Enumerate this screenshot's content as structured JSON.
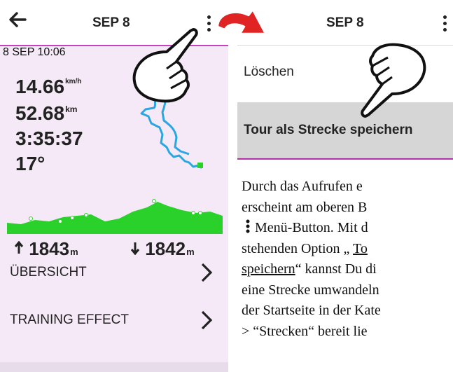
{
  "left_screen": {
    "back_icon": "arrow-left-icon",
    "title": "SEP 8",
    "menu_icon": "kebab-menu-icon",
    "timestamp": "8 SEP 10:06",
    "stats": [
      {
        "value": "14.66",
        "unit": "km/h"
      },
      {
        "value": "52.68",
        "unit": "km"
      },
      {
        "value": "3:35:37",
        "unit": ""
      },
      {
        "value": "17°",
        "unit": ""
      }
    ],
    "ascent": {
      "icon": "arrow-up-icon",
      "value": "1843",
      "unit": "m"
    },
    "descent": {
      "icon": "arrow-down-icon",
      "value": "1842",
      "unit": "m"
    },
    "rows": [
      {
        "label": "ÜBERSICHT",
        "icon": "chevron-right-icon"
      },
      {
        "label": "TRAINING EFFECT",
        "icon": "chevron-right-icon"
      }
    ],
    "colors": {
      "accent": "#c640c0",
      "route": "#29a7e1",
      "profile": "#2bd12b",
      "background": "#f5e9f7"
    }
  },
  "right_screen": {
    "title": "SEP 8",
    "menu_icon": "kebab-menu-icon",
    "menu_items": [
      "Löschen",
      "Tour als Strecke speichern"
    ],
    "selected_index": 1
  },
  "description": {
    "line1": "Durch das Aufrufen e",
    "line2": "erscheint  am oberen  B",
    "line3_icon": "kebab-menu-icon",
    "line3": " Menü-Button. Mit d",
    "line4_prefix": "stehenden Option „ ",
    "line4_link": "To",
    "line5_link": "speichern",
    "line5_suffix": "“ kannst Du di",
    "line6": "eine Strecke umwandeln",
    "line7": "der Startseite in der Kate",
    "line8": "> “Strecken“ bereit lie"
  },
  "overlays": {
    "pointer_icon": "pointing-hand-icon",
    "arrow_icon": "curved-arrow-icon",
    "arrow_color": "#e02424"
  }
}
